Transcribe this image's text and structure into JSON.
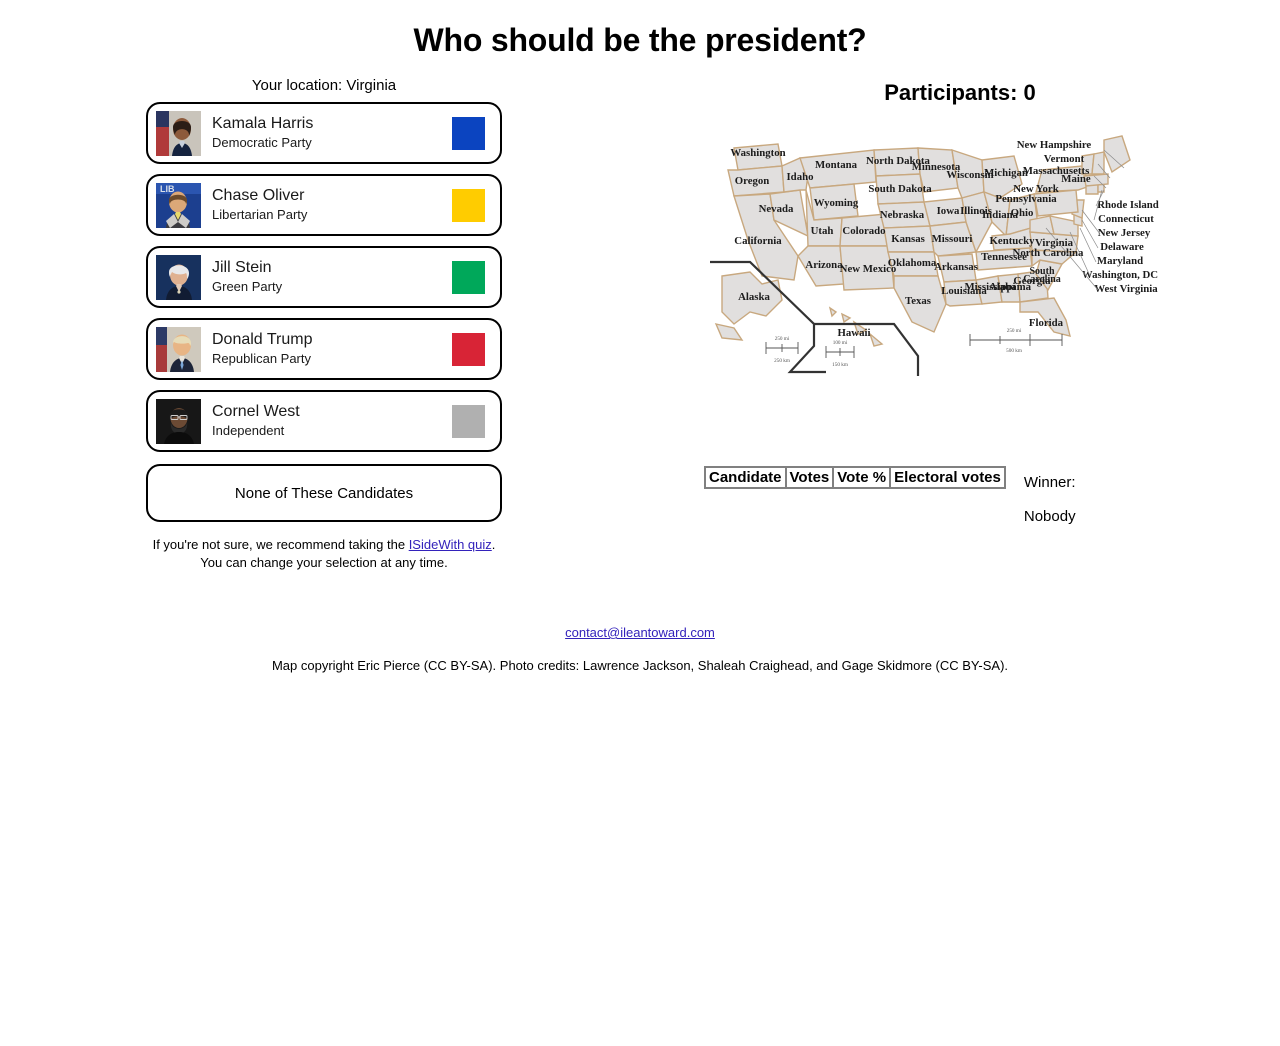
{
  "page": {
    "title": "Who should be the president?"
  },
  "location": {
    "label": "Your location: Virginia"
  },
  "candidates": [
    {
      "name": "Kamala Harris",
      "party": "Democratic Party",
      "color": "#0b44c0",
      "photo_alt": "kamala-harris-photo"
    },
    {
      "name": "Chase Oliver",
      "party": "Libertarian Party",
      "color": "#ffcc00",
      "photo_alt": "chase-oliver-photo"
    },
    {
      "name": "Jill Stein",
      "party": "Green Party",
      "color": "#00a85a",
      "photo_alt": "jill-stein-photo"
    },
    {
      "name": "Donald Trump",
      "party": "Republican Party",
      "color": "#d82436",
      "photo_alt": "donald-trump-photo"
    },
    {
      "name": "Cornel West",
      "party": "Independent",
      "color": "#b0b0b0",
      "photo_alt": "cornel-west-photo"
    }
  ],
  "none_option": {
    "label": "None of These Candidates"
  },
  "recommend": {
    "prefix": "If you're not sure, we recommend taking the ",
    "link_text": "ISideWith quiz",
    "suffix": ".",
    "second_line": "You can change your selection at any time."
  },
  "results": {
    "participants_label": "Participants: 0",
    "table_headers": [
      "Candidate",
      "Votes",
      "Vote %",
      "Electoral votes"
    ],
    "table_rows": [],
    "winner_label": "Winner:",
    "winner_value": "Nobody"
  },
  "map": {
    "state_labels": [
      "Washington",
      "Oregon",
      "Idaho",
      "Montana",
      "Wyoming",
      "Nevada",
      "Utah",
      "Colorado",
      "California",
      "Arizona",
      "New Mexico",
      "North Dakota",
      "South Dakota",
      "Nebraska",
      "Kansas",
      "Oklahoma",
      "Texas",
      "Minnesota",
      "Iowa",
      "Missouri",
      "Arkansas",
      "Louisiana",
      "Wisconsin",
      "Illinois",
      "Michigan",
      "Indiana",
      "Ohio",
      "Kentucky",
      "Tennessee",
      "Mississippi",
      "Alabama",
      "Georgia",
      "Florida",
      "South Carolina",
      "North Carolina",
      "Virginia",
      "West Virginia",
      "Maryland",
      "Delaware",
      "New Jersey",
      "Pennsylvania",
      "New York",
      "Connecticut",
      "Rhode Island",
      "Massachusetts",
      "Vermont",
      "New Hampshire",
      "Maine",
      "Washington, DC",
      "Alaska",
      "Hawaii"
    ],
    "state_fill": "#e1dfde",
    "border_color": "#c8a87f"
  },
  "footer": {
    "contact_email": "contact@ileantoward.com",
    "credits": "Map copyright Eric Pierce (CC BY-SA). Photo credits: Lawrence Jackson, Shaleah Craighead, and Gage Skidmore (CC BY-SA)."
  }
}
